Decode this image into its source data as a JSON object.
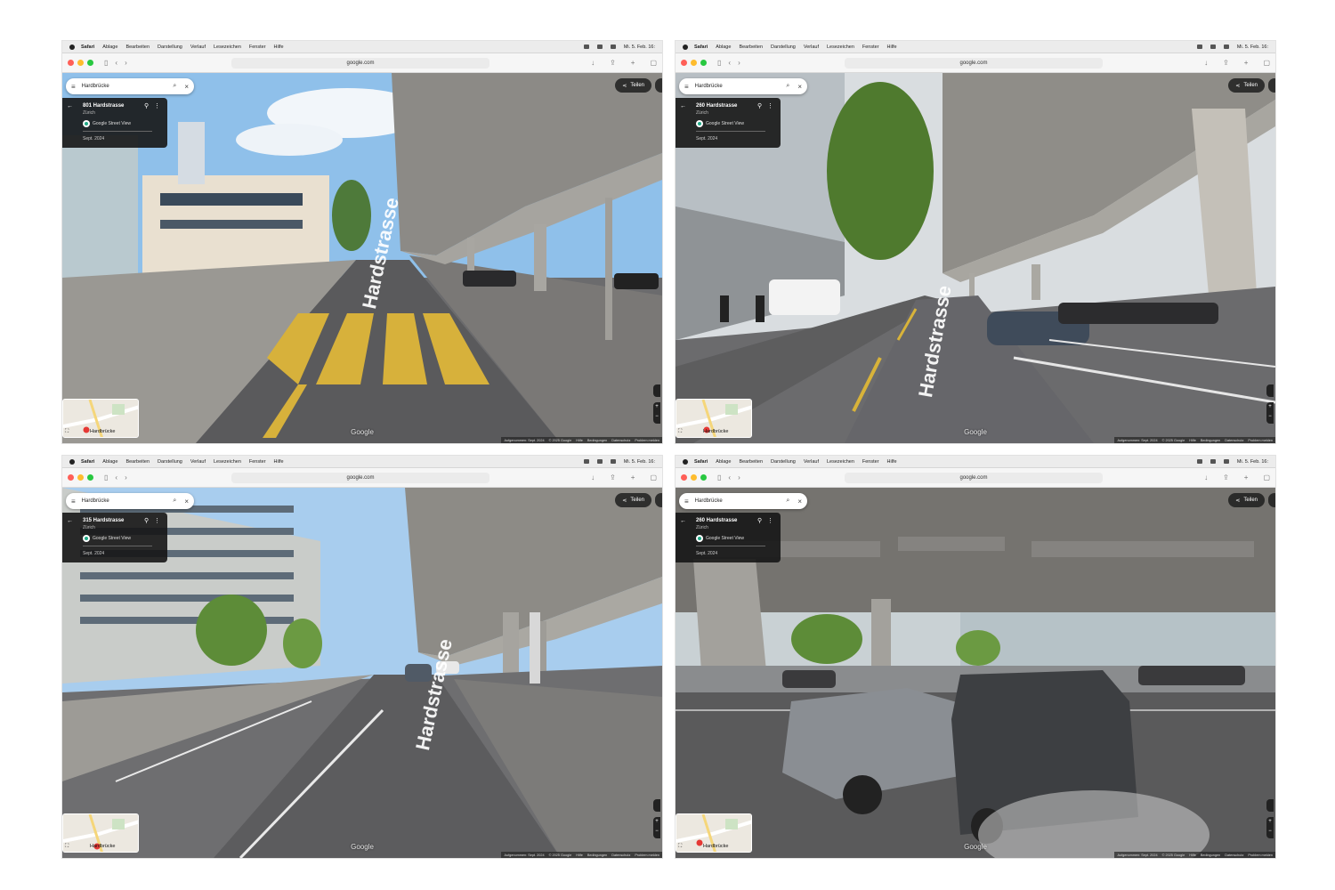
{
  "menubar": {
    "items": [
      "Safari",
      "Ablage",
      "Bearbeiten",
      "Darstellung",
      "Verlauf",
      "Lesezeichen",
      "Fenster",
      "Hilfe"
    ],
    "clock": "Mi. 5. Feb. 16:"
  },
  "browser": {
    "url": "google.com"
  },
  "panels": [
    {
      "search": "Hardbrücke",
      "place": "801 Hardstrasse",
      "city": "Zürich",
      "source": "Google Street View",
      "date": "Sept. 2024",
      "share": "Teilen",
      "minimap_label": "Hardbrücke",
      "watermark": "Google",
      "road_text": "Hardstrasse",
      "footer": [
        "Aufgenommen: Sept. 2024",
        "© 2025 Google",
        "Hilfe",
        "Bedingungen",
        "Datenschutz",
        "Problem melden"
      ]
    },
    {
      "search": "Hardbrücke",
      "place": "260 Hardstrasse",
      "city": "Zürich",
      "source": "Google Street View",
      "date": "Sept. 2024",
      "share": "Teilen",
      "minimap_label": "Hardbrücke",
      "watermark": "Google",
      "road_text": "Hardstrasse",
      "footer": [
        "Aufgenommen: Sept. 2024",
        "© 2025 Google",
        "Hilfe",
        "Bedingungen",
        "Datenschutz",
        "Problem melden"
      ]
    },
    {
      "search": "Hardbrücke",
      "place": "315 Hardstrasse",
      "city": "Zürich",
      "source": "Google Street View",
      "date": "Sept. 2024",
      "share": "Teilen",
      "minimap_label": "Hardbrücke",
      "watermark": "Google",
      "road_text": "Hardstrasse",
      "footer": [
        "Aufgenommen: Sept. 2024",
        "© 2025 Google",
        "Hilfe",
        "Bedingungen",
        "Datenschutz",
        "Problem melden"
      ]
    },
    {
      "search": "Hardbrücke",
      "place": "260 Hardstrasse",
      "city": "Zürich",
      "source": "Google Street View",
      "date": "Sept. 2024",
      "share": "Teilen",
      "minimap_label": "Hardbrücke",
      "watermark": "Google",
      "road_text": "",
      "footer": [
        "Aufgenommen: Sept. 2024",
        "© 2025 Google",
        "Hilfe",
        "Bedingungen",
        "Datenschutz",
        "Problem melden"
      ]
    }
  ],
  "icons": {
    "menu": "hamburger-icon",
    "search": "search-icon",
    "close": "close-icon",
    "back": "back-arrow-icon",
    "pin": "location-pin-icon",
    "more": "kebab-icon",
    "share": "share-icon"
  },
  "colors": {
    "sky": "#9fc6ea",
    "concrete": "#8c8a86",
    "asphalt": "#5c5c5e",
    "lane_yellow": "#d8b33a",
    "card_bg": "#161616"
  }
}
